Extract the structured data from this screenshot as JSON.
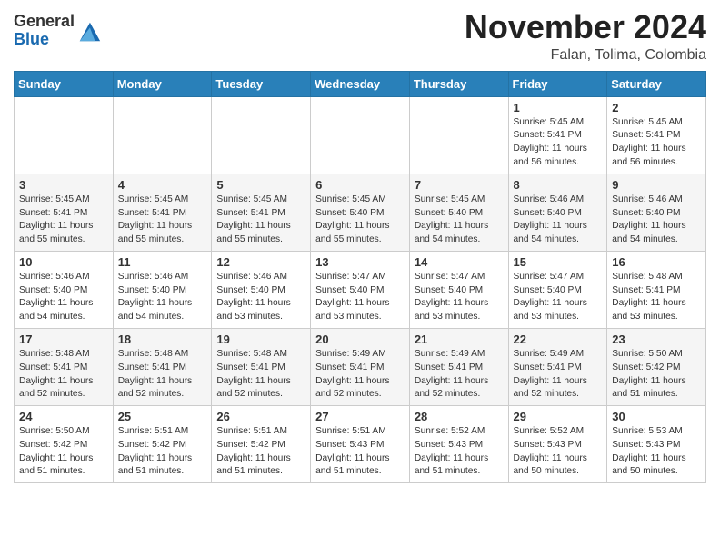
{
  "header": {
    "logo_general": "General",
    "logo_blue": "Blue",
    "month_title": "November 2024",
    "location": "Falan, Tolima, Colombia"
  },
  "weekdays": [
    "Sunday",
    "Monday",
    "Tuesday",
    "Wednesday",
    "Thursday",
    "Friday",
    "Saturday"
  ],
  "weeks": [
    [
      {
        "day": "",
        "info": ""
      },
      {
        "day": "",
        "info": ""
      },
      {
        "day": "",
        "info": ""
      },
      {
        "day": "",
        "info": ""
      },
      {
        "day": "",
        "info": ""
      },
      {
        "day": "1",
        "info": "Sunrise: 5:45 AM\nSunset: 5:41 PM\nDaylight: 11 hours\nand 56 minutes."
      },
      {
        "day": "2",
        "info": "Sunrise: 5:45 AM\nSunset: 5:41 PM\nDaylight: 11 hours\nand 56 minutes."
      }
    ],
    [
      {
        "day": "3",
        "info": "Sunrise: 5:45 AM\nSunset: 5:41 PM\nDaylight: 11 hours\nand 55 minutes."
      },
      {
        "day": "4",
        "info": "Sunrise: 5:45 AM\nSunset: 5:41 PM\nDaylight: 11 hours\nand 55 minutes."
      },
      {
        "day": "5",
        "info": "Sunrise: 5:45 AM\nSunset: 5:41 PM\nDaylight: 11 hours\nand 55 minutes."
      },
      {
        "day": "6",
        "info": "Sunrise: 5:45 AM\nSunset: 5:40 PM\nDaylight: 11 hours\nand 55 minutes."
      },
      {
        "day": "7",
        "info": "Sunrise: 5:45 AM\nSunset: 5:40 PM\nDaylight: 11 hours\nand 54 minutes."
      },
      {
        "day": "8",
        "info": "Sunrise: 5:46 AM\nSunset: 5:40 PM\nDaylight: 11 hours\nand 54 minutes."
      },
      {
        "day": "9",
        "info": "Sunrise: 5:46 AM\nSunset: 5:40 PM\nDaylight: 11 hours\nand 54 minutes."
      }
    ],
    [
      {
        "day": "10",
        "info": "Sunrise: 5:46 AM\nSunset: 5:40 PM\nDaylight: 11 hours\nand 54 minutes."
      },
      {
        "day": "11",
        "info": "Sunrise: 5:46 AM\nSunset: 5:40 PM\nDaylight: 11 hours\nand 54 minutes."
      },
      {
        "day": "12",
        "info": "Sunrise: 5:46 AM\nSunset: 5:40 PM\nDaylight: 11 hours\nand 53 minutes."
      },
      {
        "day": "13",
        "info": "Sunrise: 5:47 AM\nSunset: 5:40 PM\nDaylight: 11 hours\nand 53 minutes."
      },
      {
        "day": "14",
        "info": "Sunrise: 5:47 AM\nSunset: 5:40 PM\nDaylight: 11 hours\nand 53 minutes."
      },
      {
        "day": "15",
        "info": "Sunrise: 5:47 AM\nSunset: 5:40 PM\nDaylight: 11 hours\nand 53 minutes."
      },
      {
        "day": "16",
        "info": "Sunrise: 5:48 AM\nSunset: 5:41 PM\nDaylight: 11 hours\nand 53 minutes."
      }
    ],
    [
      {
        "day": "17",
        "info": "Sunrise: 5:48 AM\nSunset: 5:41 PM\nDaylight: 11 hours\nand 52 minutes."
      },
      {
        "day": "18",
        "info": "Sunrise: 5:48 AM\nSunset: 5:41 PM\nDaylight: 11 hours\nand 52 minutes."
      },
      {
        "day": "19",
        "info": "Sunrise: 5:48 AM\nSunset: 5:41 PM\nDaylight: 11 hours\nand 52 minutes."
      },
      {
        "day": "20",
        "info": "Sunrise: 5:49 AM\nSunset: 5:41 PM\nDaylight: 11 hours\nand 52 minutes."
      },
      {
        "day": "21",
        "info": "Sunrise: 5:49 AM\nSunset: 5:41 PM\nDaylight: 11 hours\nand 52 minutes."
      },
      {
        "day": "22",
        "info": "Sunrise: 5:49 AM\nSunset: 5:41 PM\nDaylight: 11 hours\nand 52 minutes."
      },
      {
        "day": "23",
        "info": "Sunrise: 5:50 AM\nSunset: 5:42 PM\nDaylight: 11 hours\nand 51 minutes."
      }
    ],
    [
      {
        "day": "24",
        "info": "Sunrise: 5:50 AM\nSunset: 5:42 PM\nDaylight: 11 hours\nand 51 minutes."
      },
      {
        "day": "25",
        "info": "Sunrise: 5:51 AM\nSunset: 5:42 PM\nDaylight: 11 hours\nand 51 minutes."
      },
      {
        "day": "26",
        "info": "Sunrise: 5:51 AM\nSunset: 5:42 PM\nDaylight: 11 hours\nand 51 minutes."
      },
      {
        "day": "27",
        "info": "Sunrise: 5:51 AM\nSunset: 5:43 PM\nDaylight: 11 hours\nand 51 minutes."
      },
      {
        "day": "28",
        "info": "Sunrise: 5:52 AM\nSunset: 5:43 PM\nDaylight: 11 hours\nand 51 minutes."
      },
      {
        "day": "29",
        "info": "Sunrise: 5:52 AM\nSunset: 5:43 PM\nDaylight: 11 hours\nand 50 minutes."
      },
      {
        "day": "30",
        "info": "Sunrise: 5:53 AM\nSunset: 5:43 PM\nDaylight: 11 hours\nand 50 minutes."
      }
    ]
  ]
}
